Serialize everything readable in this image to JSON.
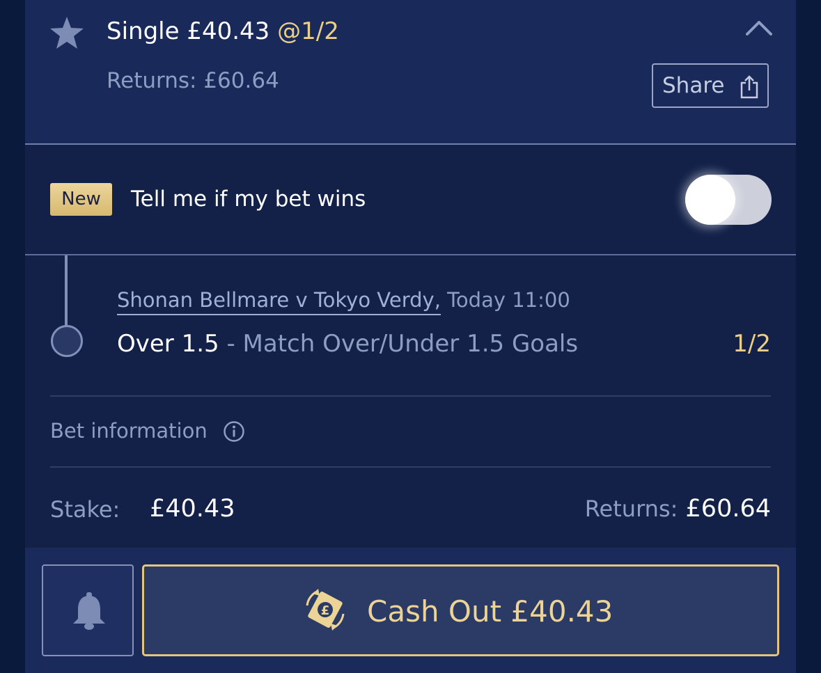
{
  "bet": {
    "type_label": "Single £40.43",
    "odds": "@1/2",
    "returns_label": "Returns: £60.64",
    "share_label": "Share"
  },
  "notify": {
    "badge": "New",
    "label": "Tell me if my bet wins",
    "toggle_on": false
  },
  "selection": {
    "match_link": "Shonan Bellmare v Tokyo Verdy,",
    "match_time": " Today 11:00",
    "pick": "Over 1.5",
    "market": " - Match Over/Under 1.5 Goals",
    "odds": "1/2"
  },
  "bet_info": {
    "label": "Bet information",
    "stake_label": "Stake:",
    "stake_value": "£40.43",
    "returns_label": "Returns:",
    "returns_value": "£60.64"
  },
  "footer": {
    "cashout_label": "Cash Out £40.43"
  },
  "colors": {
    "background": "#0a1a3c",
    "card": "#132149",
    "header": "#18295a",
    "gold": "#e9cf8a",
    "muted_text": "#8e9dc2"
  },
  "icons": [
    "star-icon",
    "chevron-up-icon",
    "share-icon",
    "info-icon",
    "bell-icon",
    "cashout-money-icon"
  ]
}
